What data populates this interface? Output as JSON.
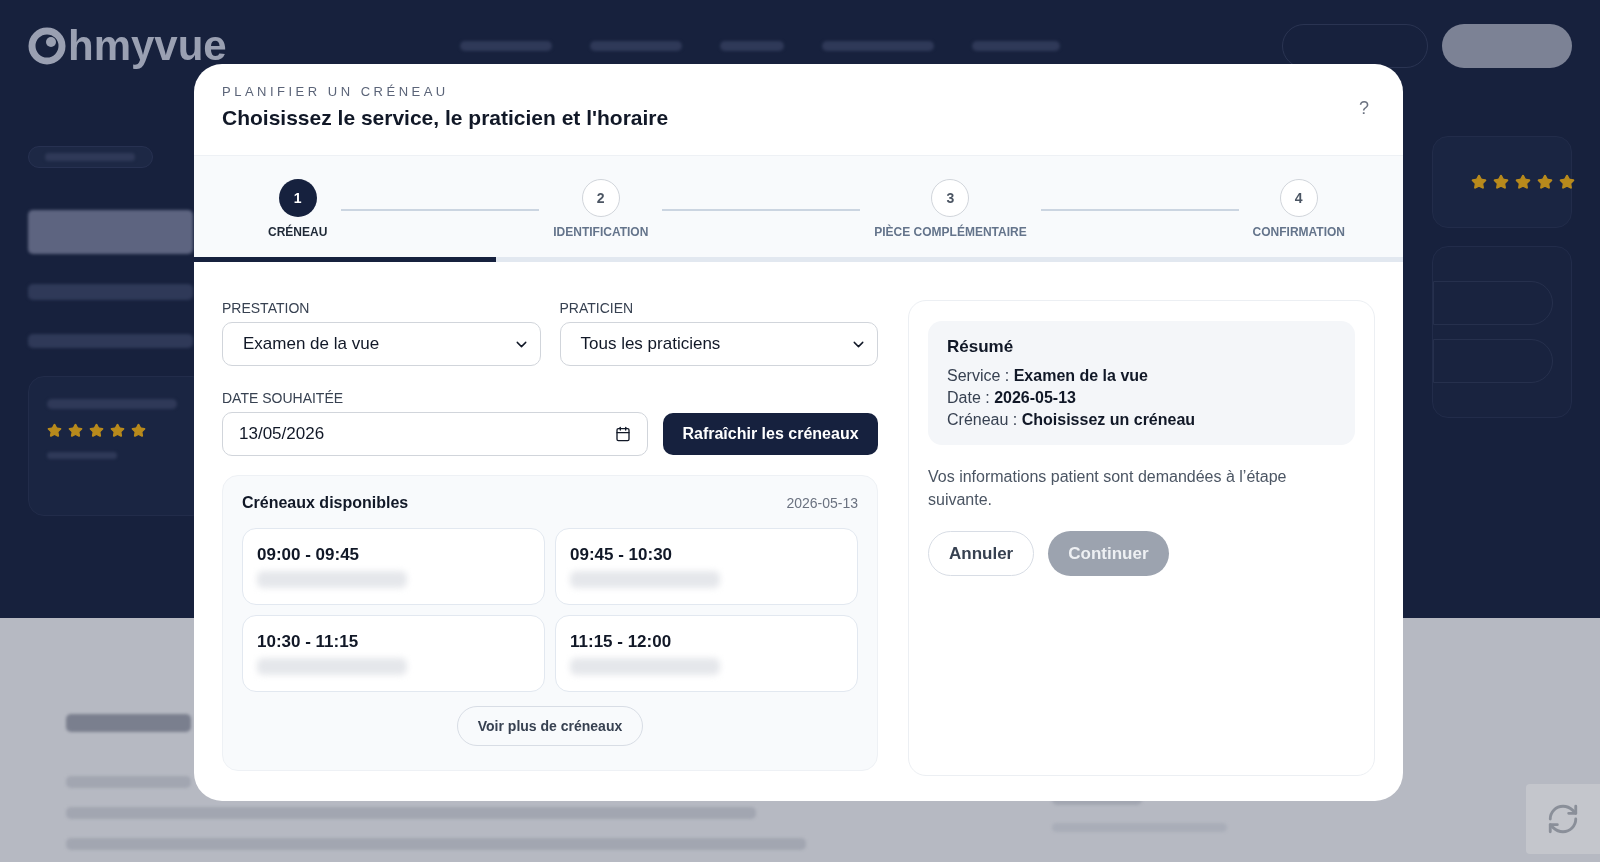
{
  "background_page": {
    "logo": "hmyvue",
    "reviews": {
      "stars": 5
    },
    "side_rating": {
      "stars": 5
    }
  },
  "dialog": {
    "eyebrow": "PLANIFIER UN CRÉNEAU",
    "title": "Choisissez le service, le praticien et l'horaire",
    "help": "?",
    "steps": [
      {
        "number": "1",
        "label": "CRÉNEAU",
        "selected": true
      },
      {
        "number": "2",
        "label": "IDENTIFICATION",
        "selected": false
      },
      {
        "number": "3",
        "label": "PIÈCE COMPLÉMENTAIRE",
        "selected": false
      },
      {
        "number": "4",
        "label": "CONFIRMATION",
        "selected": false
      }
    ],
    "progress": {
      "level": 0.25
    },
    "selects": [
      {
        "label": "PRESTATION",
        "value": "Examen de la vue"
      },
      {
        "label": "PRATICIEN",
        "value": "Tous les praticiens"
      }
    ],
    "date": {
      "label": "DATE SOUHAITÉE",
      "value": "13/05/2026"
    },
    "refresh_button": "Rafraîchir les créneaux",
    "slots": {
      "title": "Créneaux disponibles",
      "date": "2026-05-13",
      "items": [
        {
          "time": "09:00 - 09:45",
          "selected": false
        },
        {
          "time": "09:45 - 10:30",
          "selected": false
        },
        {
          "time": "10:30 - 11:15",
          "selected": false
        },
        {
          "time": "11:15 - 12:00",
          "selected": false
        }
      ],
      "more_button": "Voir plus de créneaux"
    },
    "summary": {
      "title": "Résumé",
      "lines": [
        "Service : **Examen de la vue**",
        "Date : **2026-05-13**",
        "Créneau : **Choisissez un créneau**"
      ]
    },
    "note": "Vos informations patient sont demandées à l’étape suivante.",
    "buttons": [
      {
        "label": "Annuler",
        "kind": "secondary",
        "disabled": false
      },
      {
        "label": "Continuer",
        "kind": "primary",
        "disabled": true
      }
    ]
  }
}
